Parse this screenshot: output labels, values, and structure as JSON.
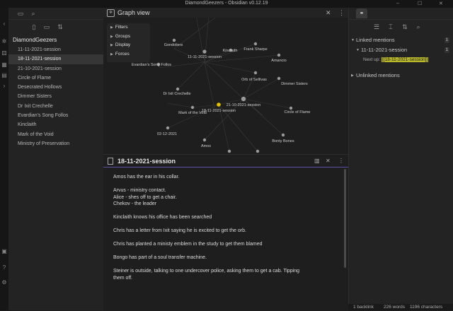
{
  "window": {
    "title": "DiamondGeezers - Obsidian v0.12.19"
  },
  "ribbon": {
    "icons": [
      "collapse-left-icon",
      "graph-icon",
      "dice-icon",
      "calendar-icon",
      "template-icon",
      "terminal-icon",
      "vault-switch-icon",
      "help-icon",
      "settings-icon"
    ]
  },
  "sidebar": {
    "vault_name": "DiamondGeezers",
    "files": [
      "11-11-2021-session",
      "18-11-2021-session",
      "21-10-2021-session",
      "Circle of Flame",
      "Desecrated Hollows",
      "Dimmer Sisters",
      "Dr Ixit Crechelle",
      "Evardian's Song Follos",
      "Kinclaith",
      "Mark of the Void",
      "Ministry of Preservation"
    ],
    "active_file": "18-11-2021-session"
  },
  "graph": {
    "tab_title": "Graph view",
    "menu": {
      "filters": "Filters",
      "groups": "Groups",
      "display": "Display",
      "forces": "Forces"
    },
    "node_labels": [
      "Gondoliers",
      "Kinclaith",
      "Frank Sharpe",
      "11-11-2021-session",
      "Amancio",
      "Evardian's Song Follos",
      "Orb of Sellivas",
      "Dimmer Sisters",
      "Dr Ixit Crechelle",
      "21-10-2021-session",
      "Mark of the Void",
      "18-11-2021-session",
      "Circle of Flame",
      "02-12-2021",
      "Bonty Bones",
      "Amos"
    ],
    "accent_color": "#e5c100"
  },
  "editor": {
    "title": "18-11-2021-session",
    "lines": [
      "Amos has the ear in his collar.",
      "",
      "Arvus - ministry contact.",
      "Alice - shes off to get a chair.",
      "Chekov - the leader",
      "",
      "Kinclaith knows his office has been searched",
      "",
      "Chris has a letter from Ixit saying he is excited to get the orb.",
      "",
      "Chris has planted a ministy emblem in the study to get them blamed",
      "",
      "Bongo has part of a soul transfer machine.",
      "",
      "Steiner is outside, talking to one undercover police, asking them to get a cab. Tipping",
      "them off."
    ]
  },
  "backlinks": {
    "linked_title": "Linked mentions",
    "linked_count": "1",
    "source_file": "11-11-2021-session",
    "source_count": "1",
    "mention_prefix": "Next up:",
    "mention_link": "[[18-11-2021-session]]",
    "unlinked_title": "Unlinked mentions"
  },
  "status": {
    "backlinks": "1 backlink",
    "words": "226 words",
    "characters": "1196 characters"
  }
}
